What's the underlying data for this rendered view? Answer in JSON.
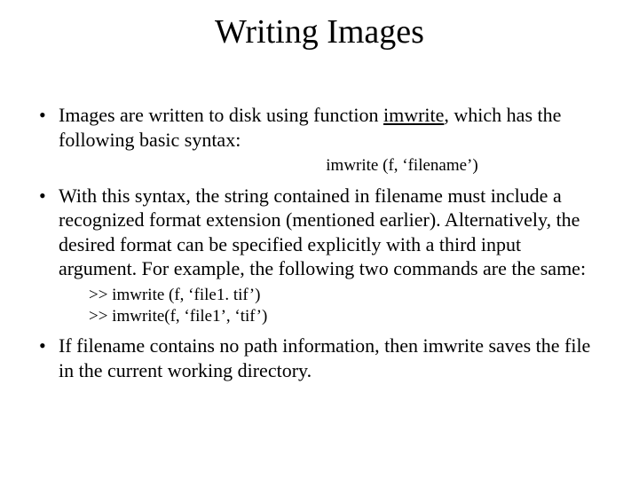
{
  "title": "Writing Images",
  "bullets": {
    "b1_pre": "Images are written to disk using function ",
    "b1_func": "imwrite",
    "b1_post": ", which has the following basic syntax:",
    "syntax": "imwrite (f, ‘filename’)",
    "b2": "With this syntax, the string contained in filename must include a recognized format extension (mentioned earlier). Alternatively, the desired format can be specified explicitly with  a third input argument. For example, the following two commands are the same:",
    "ex1": ">> imwrite (f, ‘file1. tif’)",
    "ex2": ">> imwrite(f, ‘file1’, ‘tif’)",
    "b3": "If filename contains no path information, then imwrite saves the file in the current working directory."
  }
}
